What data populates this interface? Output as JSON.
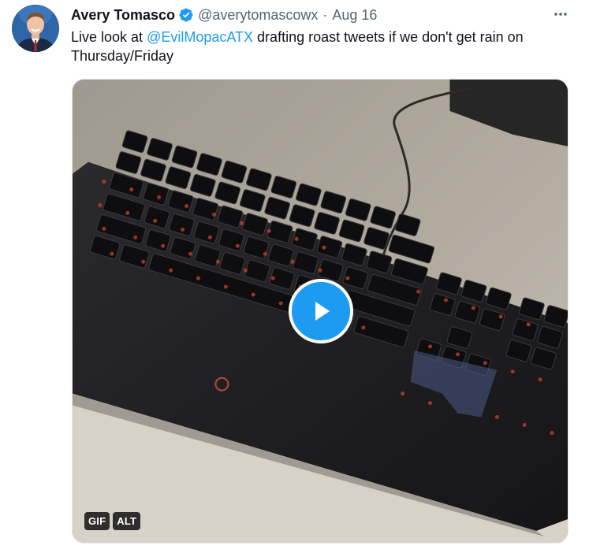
{
  "tweet": {
    "display_name": "Avery Tomasco",
    "verified": true,
    "handle": "@averytomascowx",
    "separator": "·",
    "timestamp": "Aug 16",
    "text_before": "Live look at ",
    "mention": "@EvilMopacATX",
    "text_after": " drafting roast tweets if we don't get rain on Thursday/Friday"
  },
  "media": {
    "type_badge": "GIF",
    "alt_badge": "ALT"
  },
  "icons": {
    "verified": "verified-badge-icon",
    "more": "more-dots-icon",
    "play": "play-icon"
  },
  "colors": {
    "accent": "#1d9bf0",
    "text": "#0f1419",
    "secondary_text": "#536471"
  }
}
